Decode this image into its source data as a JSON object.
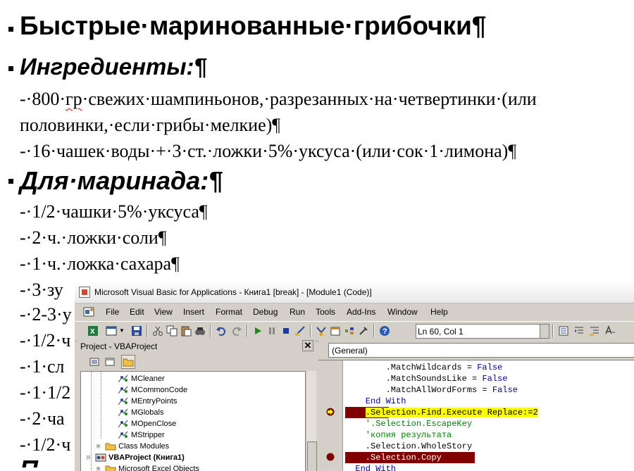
{
  "document": {
    "heading1": "Быстрые·маринованные·грибочки¶",
    "heading2": "Ингредиенты:¶",
    "ingredients_line1_pre": "-·800·",
    "ingredients_line1_err": "гр",
    "ingredients_line1_post": "·свежих·шампиньонов,·разрезанных·на·четвертинки·(или",
    "ingredients_line2": "половинки,·если·грибы·мелкие)¶",
    "ingredients_line3": "-·16·чашек·воды·+·3·ст.·ложки·5%·уксуса·(или·сок·1·лимона)¶",
    "heading3": "Для·маринада:¶",
    "marinade": [
      "-·1/2·чашки·5%·уксуса¶",
      "-·2·ч.·ложки·соли¶",
      "-·1·ч.·ложка·сахара¶",
      "-·3·зу",
      "-·2-3·у",
      "-·1/2·ч",
      "-·1·сл",
      "-·1·1/2",
      "-·2·ча",
      "-·1/2·ч"
    ],
    "last_heading_fragment": "П"
  },
  "vbe": {
    "title": "Microsoft Visual Basic for Applications - Книга1 [break] - [Module1 (Code)]",
    "menu": [
      "File",
      "Edit",
      "View",
      "Insert",
      "Format",
      "Debug",
      "Run",
      "Tools",
      "Add-Ins",
      "Window",
      "Help"
    ],
    "status": "Ln 60, Col 1",
    "project_title": "Project - VBAProject",
    "project_close": "✕",
    "tree": [
      "MCleaner",
      "MCommonCode",
      "MEntryPoints",
      "MGlobals",
      "MOpenClose",
      "MStripper",
      "Class Modules",
      "VBAProject (Книга1)",
      "Microsoft Excel Objects"
    ],
    "object_combo": "(General)",
    "code": [
      "        .MatchWildcards = ",
      "        .MatchSoundsLike = ",
      "        .MatchAllWordForms = ",
      "    End With",
      "    .Selection.Find.Execute Replace:=2",
      "    '.Selection.EscapeKey",
      "    'копия результата",
      "    .Selection.WholeStory",
      "    .Selection.Copy",
      "  End With"
    ],
    "false_kw": "False"
  },
  "colors": {
    "breakpoint": "#800000",
    "exec_line": "#ffff00",
    "keyword": "#00008b",
    "comment": "#008000"
  }
}
